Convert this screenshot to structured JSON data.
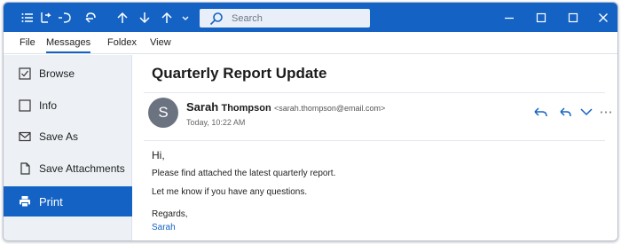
{
  "titlebar": {
    "search_placeholder": "Search",
    "bg_color": "#1463c4",
    "icons": [
      "list-icon",
      "undo-all-icon",
      "undo-icon",
      "redo-icon",
      "up-arrow-icon",
      "down-arrow-icon",
      "up-arrow-icon",
      "chevron-down-icon",
      "search-icon",
      "minimize-icon",
      "maximize-icon",
      "close-icon"
    ]
  },
  "menu": {
    "items": [
      "File",
      "Messages",
      "Foldex",
      "View"
    ],
    "active": "Messages"
  },
  "sidebar": {
    "items": [
      {
        "label": "Browse",
        "icon": "checkbox-icon"
      },
      {
        "label": "Info",
        "icon": "square-icon"
      },
      {
        "label": "Save As",
        "icon": "envelope-icon"
      },
      {
        "label": "Save Attachments",
        "icon": "document-icon"
      },
      {
        "label": "Print",
        "icon": "printer-icon",
        "selected": true
      }
    ]
  },
  "email": {
    "subject": "Quarterly Report Update",
    "avatar_initial": "S",
    "sender_first": "Sarah",
    "sender_last": "Thompson",
    "sender_email": "<sarah.thompson@email.com>",
    "date": "Today, 10:22 AM",
    "actions": [
      "reply-icon",
      "reply-all-icon",
      "chevron-down-icon",
      "more-icon"
    ],
    "body": {
      "greeting": "Hi,",
      "line1": "Please find attached the latest quarterly report.",
      "line2": "Let me know if you have any questions.",
      "closing": "Regards,",
      "signature": "Sarah"
    }
  },
  "colors": {
    "accent": "#1463c4",
    "sidebar_bg": "#edf1f5",
    "avatar_bg": "#6b7380"
  }
}
